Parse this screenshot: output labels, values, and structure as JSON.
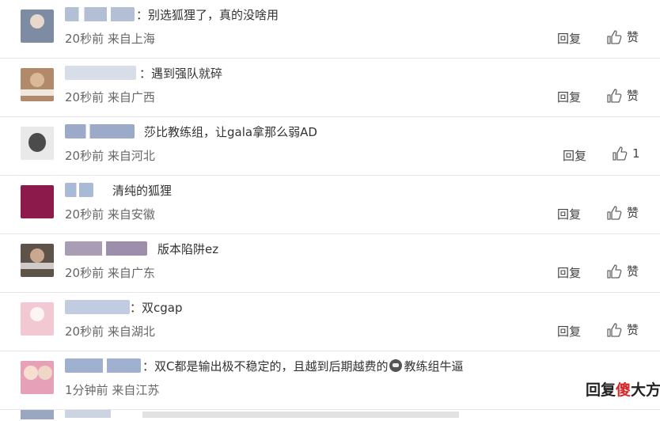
{
  "comments": [
    {
      "text": "：别选狐狸了，真的没啥用",
      "time": "20秒前",
      "location": "来自上海",
      "reply_label": "回复",
      "like_label": "赞",
      "avatar_color": "#7d8ba3",
      "name_color": "#a6b4cc"
    },
    {
      "text": "：遇到强队就碎",
      "time": "20秒前",
      "location": "来自广西",
      "reply_label": "回复",
      "like_label": "赞",
      "avatar_color": "#b08a6b",
      "name_color": "#b7c2d6"
    },
    {
      "text": "莎比教练组，让gala拿那么弱AD",
      "time": "20秒前",
      "location": "来自河北",
      "reply_label": "回复",
      "like_label": "1",
      "avatar_color": "#4b4b4b",
      "name_color": "#8a9bc0"
    },
    {
      "text": "清纯的狐狸",
      "time": "20秒前",
      "location": "来自安徽",
      "reply_label": "回复",
      "like_label": "赞",
      "avatar_color": "#8c1a4a",
      "name_color": "#9aaed0"
    },
    {
      "text": "版本陷阱ez",
      "time": "20秒前",
      "location": "来自广东",
      "reply_label": "回复",
      "like_label": "赞",
      "avatar_color": "#5d5348",
      "name_color": "#9a8aa8"
    },
    {
      "text": "：双cgap",
      "time": "20秒前",
      "location": "来自湖北",
      "reply_label": "回复",
      "like_label": "赞",
      "avatar_color": "#f2c9d2",
      "name_color": "#a8b6d4"
    },
    {
      "text_before": "：双C都是输出极不稳定的，且越到后期越费的",
      "text_after": "教练组牛逼",
      "emoji_name": "face-emoji",
      "time": "1分钟前",
      "location": "来自江苏",
      "reply_label": "回复",
      "avatar_color": "#e6a0b8",
      "name_color": "#8fa2c9"
    }
  ],
  "watermark": {
    "part1": "回复",
    "part2": "傻",
    "part3": "大方"
  },
  "colors": {
    "text": "#333333",
    "meta": "#666666",
    "divider": "#e6e6e6",
    "watermark_red": "#d62828"
  },
  "icons": {
    "like": "thumbs-up-icon"
  }
}
